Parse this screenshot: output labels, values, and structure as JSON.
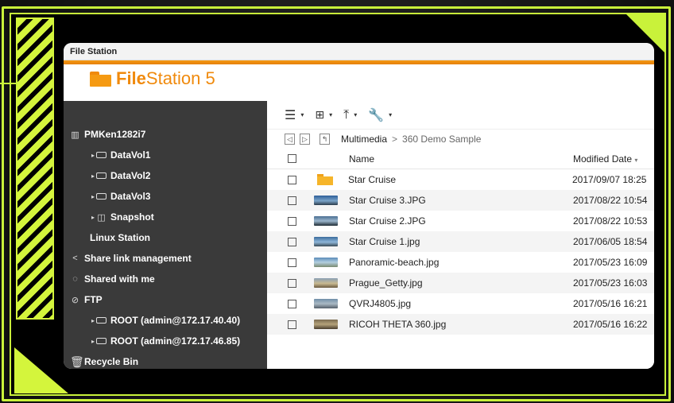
{
  "window": {
    "title": "File Station"
  },
  "logo": {
    "bold": "File",
    "light": "Station 5"
  },
  "sidebar": {
    "items": [
      {
        "label": "PMKen1282i7",
        "icon": "server-icon",
        "level": 0
      },
      {
        "label": "DataVol1",
        "icon": "drive-icon",
        "level": 1
      },
      {
        "label": "DataVol2",
        "icon": "drive-icon",
        "level": 1
      },
      {
        "label": "DataVol3",
        "icon": "drive-icon",
        "level": 1
      },
      {
        "label": "Snapshot",
        "icon": "snapshot-icon",
        "level": 1
      },
      {
        "label": "Linux Station",
        "icon": "",
        "level": 0
      },
      {
        "label": "Share link management",
        "icon": "share-icon",
        "level": 0
      },
      {
        "label": "Shared with me",
        "icon": "shared-icon",
        "level": 0
      },
      {
        "label": "FTP",
        "icon": "ftp-icon",
        "level": 0
      },
      {
        "label": "ROOT (admin@172.17.40.40)",
        "icon": "drive-icon",
        "level": 1
      },
      {
        "label": "ROOT (admin@172.17.46.85)",
        "icon": "drive-icon",
        "level": 1
      },
      {
        "label": "Recycle Bin",
        "icon": "trash-icon",
        "level": 0
      }
    ]
  },
  "path": {
    "parent": "Multimedia",
    "separator": ">",
    "current": "360 Demo Sample"
  },
  "table": {
    "headers": {
      "name": "Name",
      "date": "Modified Date"
    },
    "rows": [
      {
        "name": "Star Cruise",
        "date": "2017/09/07 18:25",
        "type": "folder"
      },
      {
        "name": "Star Cruise 3.JPG",
        "date": "2017/08/22 10:54",
        "type": "image"
      },
      {
        "name": "Star Cruise 2.JPG",
        "date": "2017/08/22 10:53",
        "type": "image"
      },
      {
        "name": "Star Cruise 1.jpg",
        "date": "2017/06/05 18:54",
        "type": "image"
      },
      {
        "name": "Panoramic-beach.jpg",
        "date": "2017/05/23 16:09",
        "type": "image"
      },
      {
        "name": "Prague_Getty.jpg",
        "date": "2017/05/23 16:03",
        "type": "image"
      },
      {
        "name": "QVRJ4805.jpg",
        "date": "2017/05/16 16:21",
        "type": "image"
      },
      {
        "name": "RICOH THETA 360.jpg",
        "date": "2017/05/16 16:22",
        "type": "image"
      }
    ]
  },
  "colors": {
    "accent": "#c9f23a",
    "orange": "#f08a0d",
    "sidebar": "#3a3a3a"
  }
}
